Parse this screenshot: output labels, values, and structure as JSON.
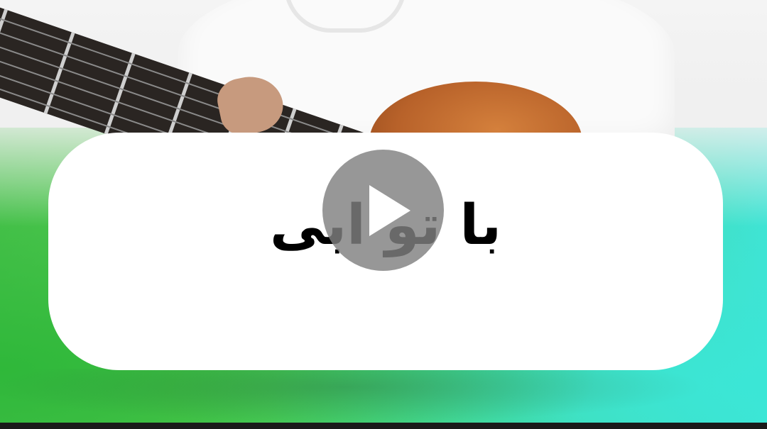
{
  "video": {
    "overlay_title": "با تو ابی",
    "play_icon": "play-icon",
    "colors": {
      "card": "#ffffff",
      "play_button": "#808080",
      "gradient_green": "#49c24c",
      "gradient_teal": "#40e3d4",
      "title_text": "#000000"
    }
  }
}
